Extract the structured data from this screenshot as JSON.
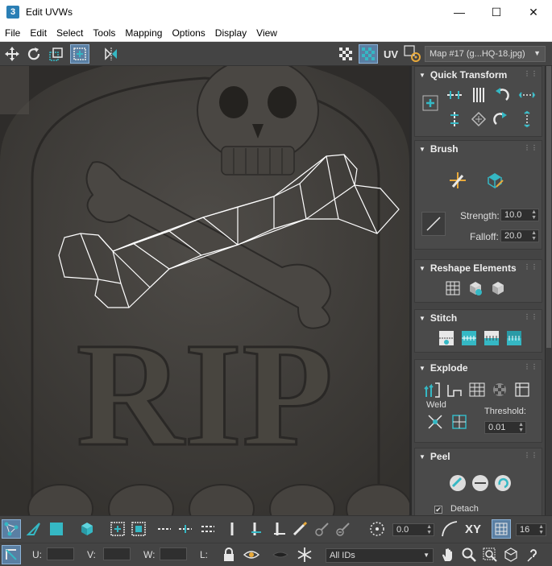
{
  "window": {
    "app_badge": "3",
    "title": "Edit UVWs",
    "minimize": "—",
    "maximize": "☐",
    "close": "✕"
  },
  "menu": [
    "File",
    "Edit",
    "Select",
    "Tools",
    "Mapping",
    "Options",
    "Display",
    "View"
  ],
  "toolbar": {
    "uv_label": "UV",
    "map_selector": "Map #17 (g...HQ-18.jpg)"
  },
  "viewport": {
    "text": "RIP"
  },
  "panels": {
    "quick_transform": {
      "title": "Quick Transform"
    },
    "brush": {
      "title": "Brush",
      "strength_label": "Strength:",
      "strength_value": "10.0",
      "falloff_label": "Falloff:",
      "falloff_value": "20.0"
    },
    "reshape": {
      "title": "Reshape Elements"
    },
    "stitch": {
      "title": "Stitch"
    },
    "explode": {
      "title": "Explode",
      "weld_label": "Weld",
      "threshold_label": "Threshold:",
      "threshold_value": "0.01"
    },
    "peel": {
      "title": "Peel",
      "detach_label": "Detach",
      "detach_checked": true
    }
  },
  "bottom": {
    "rotate_value": "0.0",
    "xy_label": "XY",
    "count_value": "16",
    "u_label": "U:",
    "v_label": "V:",
    "w_label": "W:",
    "l_label": "L:",
    "ids_select": "All IDs"
  },
  "colors": {
    "accent": "#35b8c4",
    "panel": "#444444",
    "active": "#5a7fa3"
  }
}
